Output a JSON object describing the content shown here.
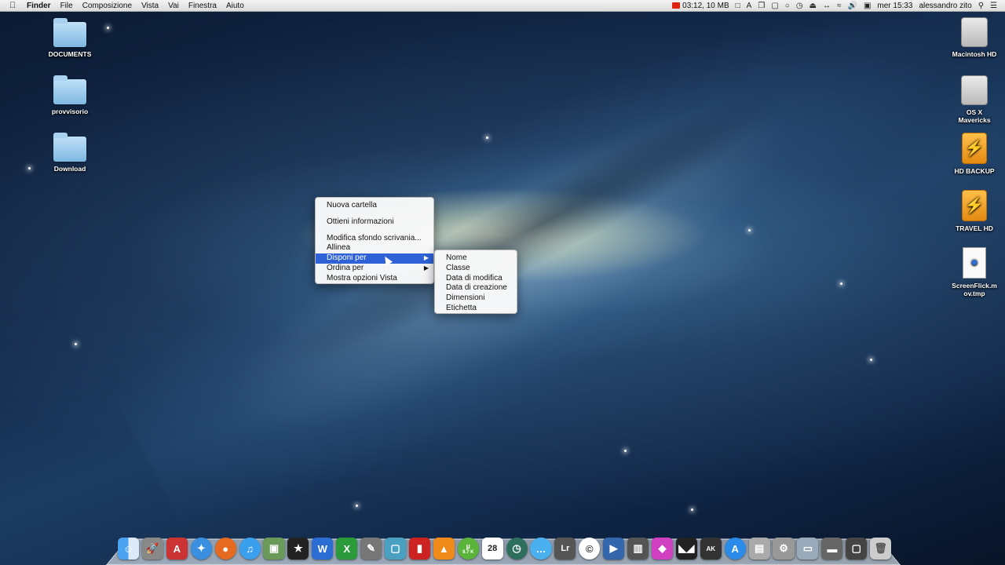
{
  "menubar": {
    "apple_icon": "apple-icon",
    "app_name": "Finder",
    "menus": [
      "File",
      "Composizione",
      "Vista",
      "Vai",
      "Finestra",
      "Aiuto"
    ],
    "recording": "03:12, 10 MB",
    "datetime": "mer 15:33",
    "user": "alessandro zito"
  },
  "desktop_left": [
    {
      "label": "DOCUMENTS"
    },
    {
      "label": "provvisorio"
    },
    {
      "label": "Download"
    }
  ],
  "desktop_right": [
    {
      "label": "Macintosh HD"
    },
    {
      "label": "OS X Mavericks"
    },
    {
      "label": "HD BACKUP"
    },
    {
      "label": "TRAVEL HD"
    },
    {
      "label": "ScreenFlick.mov.tmp"
    }
  ],
  "context_menu": {
    "items": [
      "Nuova cartella",
      "Ottieni informazioni",
      "Modifica sfondo scrivania...",
      "Allinea",
      "Disponi per",
      "Ordina per",
      "Mostra opzioni Vista"
    ]
  },
  "submenu": {
    "items": [
      "Nome",
      "Classe",
      "Data di modifica",
      "Data di creazione",
      "Dimensioni",
      "Etichetta"
    ]
  },
  "dock": {
    "badges": {
      "utorrent": "9.7 K",
      "calendar": "28"
    }
  },
  "colors": {
    "highlight": "#2f62d6",
    "recording": "#dd2211"
  }
}
